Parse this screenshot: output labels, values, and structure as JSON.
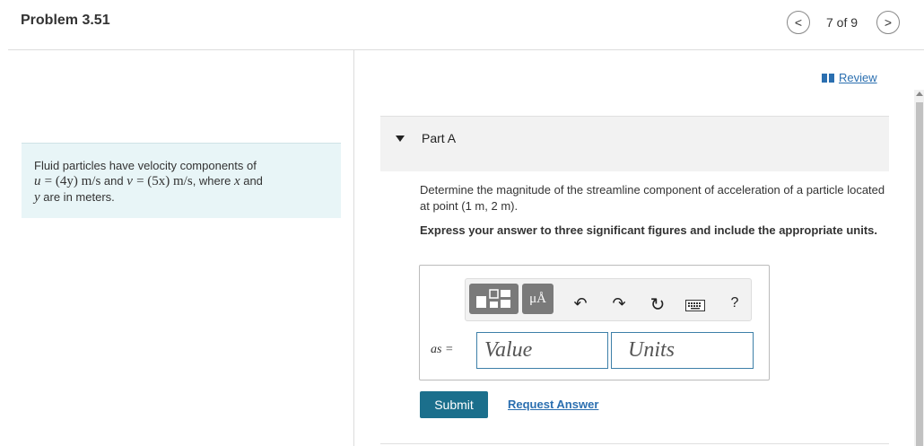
{
  "header": {
    "title": "Problem 3.51",
    "pager": "7 of 9",
    "prev_symbol": "<",
    "next_symbol": ">"
  },
  "problem": {
    "intro": "Fluid particles have velocity components of",
    "u_sym": "u",
    "u_expr": "= (4y) m/s",
    "and1": " and ",
    "v_sym": "v",
    "v_expr": "= (5x) m/s",
    "where": ", where ",
    "x_sym": "x",
    "and2": " and",
    "y_sym": "y",
    "tail": " are in meters."
  },
  "review": {
    "label": "Review",
    "icon": "book-icon"
  },
  "part": {
    "title": "Part A",
    "question": "Determine the magnitude of the streamline component of acceleration of a particle located at point (1 m, 2 m).",
    "instructions": "Express your answer to three significant figures and include the appropriate units."
  },
  "toolbar": {
    "units_label": "μÅ",
    "undo_symbol": "↶",
    "redo_symbol": "↷",
    "reset_symbol": "↻",
    "help_label": "?"
  },
  "answer": {
    "variable": "as =",
    "value_placeholder": "Value",
    "units_placeholder": "Units"
  },
  "actions": {
    "submit": "Submit",
    "request": "Request Answer"
  },
  "colors": {
    "accent": "#1b6f8c",
    "link": "#2b6fb0",
    "problem_bg": "#e8f5f7",
    "part_bg": "#f2f2f2"
  }
}
